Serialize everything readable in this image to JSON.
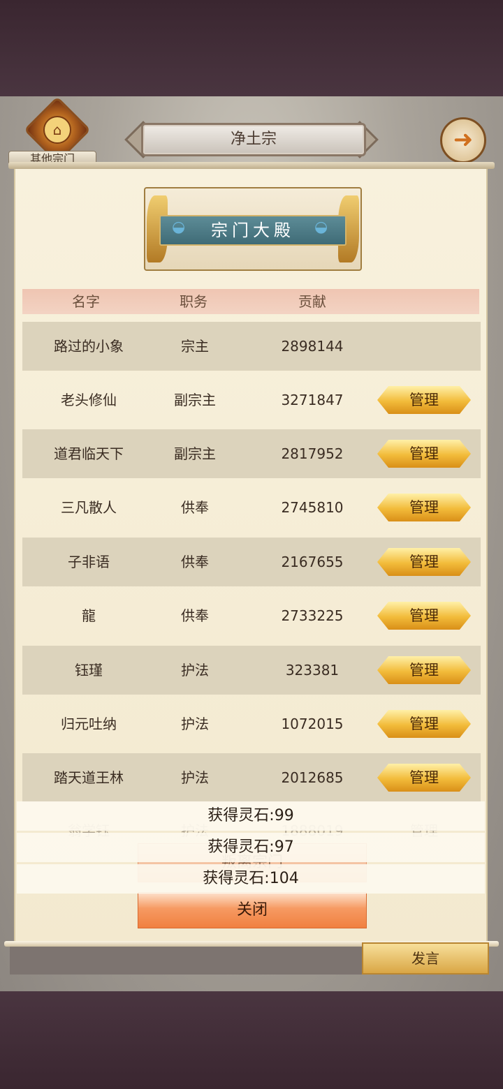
{
  "header": {
    "other_sects_label": "其他宗门",
    "sect_name": "净土宗",
    "back_icon": "back-arrow-icon"
  },
  "banner": {
    "title": "宗门大殿"
  },
  "columns": {
    "name": "名字",
    "role": "职务",
    "contribution": "贡献"
  },
  "members": [
    {
      "name": "路过的小象",
      "role": "宗主",
      "contribution": "2898144",
      "action": ""
    },
    {
      "name": "老头修仙",
      "role": "副宗主",
      "contribution": "3271847",
      "action": "管理"
    },
    {
      "name": "道君临天下",
      "role": "副宗主",
      "contribution": "2817952",
      "action": "管理"
    },
    {
      "name": "三凡散人",
      "role": "供奉",
      "contribution": "2745810",
      "action": "管理"
    },
    {
      "name": "子非语",
      "role": "供奉",
      "contribution": "2167655",
      "action": "管理"
    },
    {
      "name": "龍",
      "role": "供奉",
      "contribution": "2733225",
      "action": "管理"
    },
    {
      "name": "钰瑾",
      "role": "护法",
      "contribution": "323381",
      "action": "管理"
    },
    {
      "name": "归元吐纳",
      "role": "护法",
      "contribution": "1072015",
      "action": "管理"
    },
    {
      "name": "踏天道王林",
      "role": "护法",
      "contribution": "2012685",
      "action": "管理"
    },
    {
      "name": "翁学钰",
      "role": "护法",
      "contribution": "1888019",
      "action": "管理"
    }
  ],
  "buttons": {
    "leave": "叛离宗门",
    "close": "关闭",
    "post": "发言"
  },
  "toasts": [
    "获得灵石:99",
    "获得灵石:97",
    "获得灵石:104"
  ]
}
